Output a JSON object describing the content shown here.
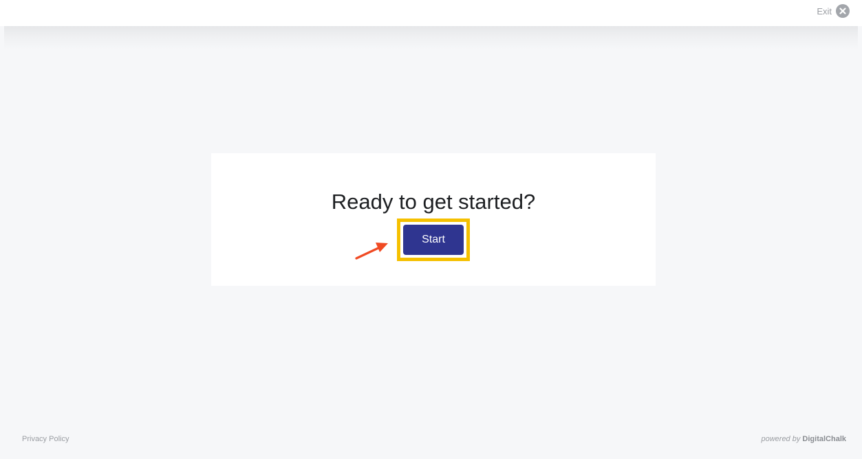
{
  "header": {
    "exit_label": "Exit",
    "exit_icon": "close-circle-icon"
  },
  "main": {
    "title": "Ready to get started?",
    "start_label": "Start",
    "highlight_color": "#f5c000",
    "arrow_color": "#f04a23",
    "button_color": "#2f3590"
  },
  "footer": {
    "privacy_label": "Privacy Policy",
    "powered_prefix": "powered by",
    "powered_brand": "DigitalChalk"
  }
}
